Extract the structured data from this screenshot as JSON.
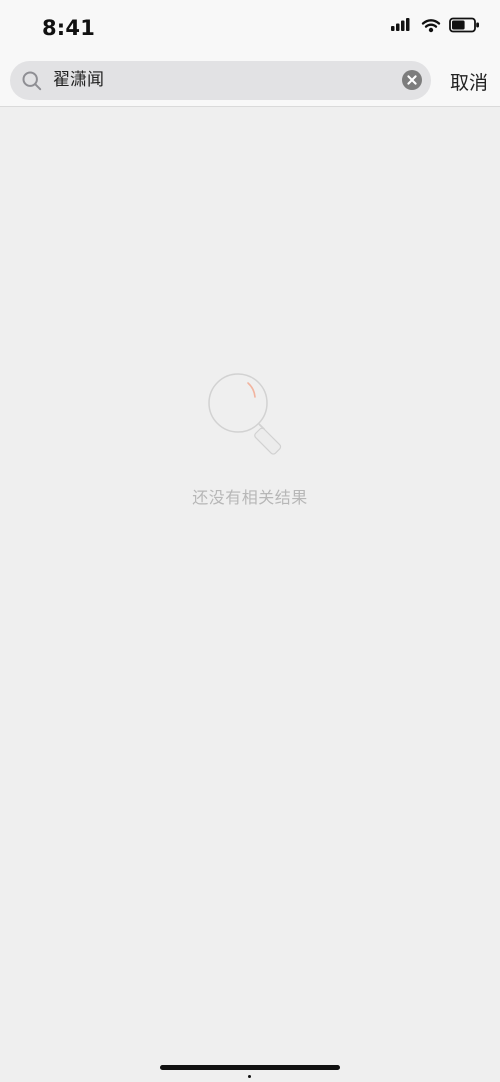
{
  "status_bar": {
    "time": "8:41",
    "signal_icon": "signal-icon",
    "wifi_icon": "wifi-icon",
    "battery_icon": "battery-icon",
    "battery_level": 0.6
  },
  "search": {
    "query": "翟潇闻",
    "search_icon": "search-icon",
    "clear_icon": "clear-icon",
    "cancel_label": "取消"
  },
  "empty_state": {
    "icon": "magnifier-illustration-icon",
    "message": "还没有相关结果"
  }
}
